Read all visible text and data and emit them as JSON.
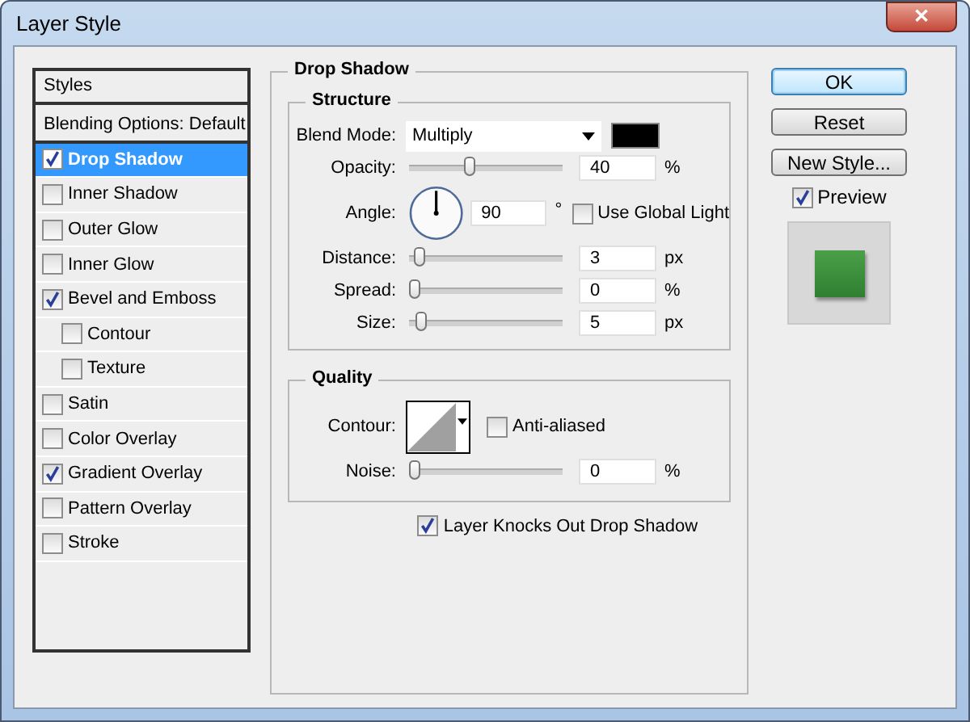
{
  "window": {
    "title": "Layer Style",
    "close": "✕"
  },
  "styles": [
    {
      "kind": "header",
      "label": "Styles"
    },
    {
      "kind": "plain",
      "label": "Blending Options: Default",
      "selected": false
    },
    {
      "kind": "check",
      "label": "Drop Shadow",
      "checked": true,
      "selected": true
    },
    {
      "kind": "check",
      "label": "Inner Shadow",
      "checked": false,
      "selected": false
    },
    {
      "kind": "check",
      "label": "Outer Glow",
      "checked": false,
      "selected": false
    },
    {
      "kind": "check",
      "label": "Inner Glow",
      "checked": false,
      "selected": false
    },
    {
      "kind": "check",
      "label": "Bevel and Emboss",
      "checked": true,
      "selected": false,
      "children": [
        {
          "label": "Contour",
          "checked": false,
          "selected": false
        },
        {
          "label": "Texture",
          "checked": false,
          "selected": false
        }
      ]
    },
    {
      "kind": "check",
      "label": "Satin",
      "checked": false,
      "selected": false
    },
    {
      "kind": "check",
      "label": "Color Overlay",
      "checked": false,
      "selected": false
    },
    {
      "kind": "check",
      "label": "Gradient Overlay",
      "checked": true,
      "selected": false
    },
    {
      "kind": "check",
      "label": "Pattern Overlay",
      "checked": false,
      "selected": false
    },
    {
      "kind": "check",
      "label": "Stroke",
      "checked": false,
      "selected": false
    }
  ],
  "panel": {
    "title": "Drop Shadow",
    "structure": {
      "title": "Structure",
      "blend_mode": {
        "label": "Blend Mode:",
        "value": "Multiply",
        "color": "#000000"
      },
      "opacity": {
        "label": "Opacity:",
        "level": 0.4,
        "value": "40",
        "unit": "%"
      },
      "angle": {
        "label": "Angle:",
        "value": "90",
        "unit": "°",
        "global_light": {
          "label": "Use Global Light",
          "checked": false
        }
      },
      "sliders": [
        {
          "label": "Distance:",
          "level": 0.03,
          "value": "3",
          "unit": "px"
        },
        {
          "label": "Spread:",
          "level": 0.0,
          "value": "0",
          "unit": "%"
        },
        {
          "label": "Size:",
          "level": 0.05,
          "value": "5",
          "unit": "px"
        }
      ]
    },
    "quality": {
      "title": "Quality",
      "contour": {
        "label": "Contour:"
      },
      "anti_aliased": {
        "label": "Anti-aliased",
        "checked": false
      },
      "noise": {
        "label": "Noise:",
        "level": 0.0,
        "value": "0",
        "unit": "%"
      }
    },
    "knockout": {
      "label": "Layer Knocks Out Drop Shadow",
      "checked": true
    }
  },
  "buttons": [
    "OK",
    "Reset",
    "New Style..."
  ],
  "preview": {
    "label": "Preview",
    "checked": true
  }
}
